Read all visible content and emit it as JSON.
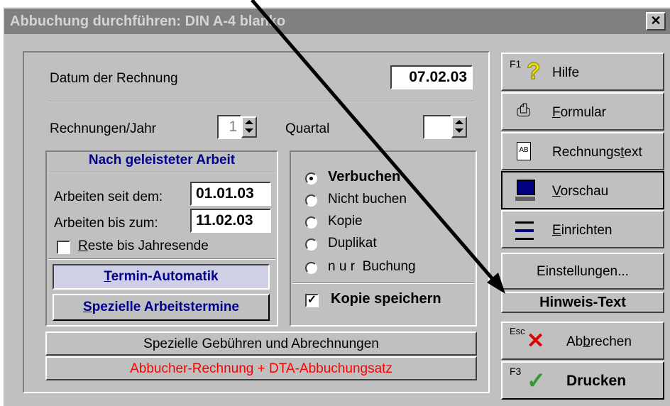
{
  "window": {
    "title": "Abbuchung durchführen: DIN A-4 blanko",
    "close_glyph": "✕"
  },
  "form": {
    "date_label": "Datum der Rechnung",
    "date_value": "07.02.03",
    "invoices_per_year_label": "Rechnungen/Jahr",
    "invoices_per_year_value": "1",
    "quarter_label": "Quartal",
    "quarter_value": ""
  },
  "work_group": {
    "title": "Nach geleisteter Arbeit",
    "since_label": "Arbeiten seit dem:",
    "since_value": "01.01.03",
    "until_label": "Arbeiten bis zum:",
    "until_value": "11.02.03",
    "rest_label_first": "R",
    "rest_label_rest": "este bis Jahresende",
    "rest_checked": false,
    "termin_first": "T",
    "termin_rest": "ermin-Automatik",
    "spezielle_first": "S",
    "spezielle_rest": "pezielle Arbeitstermine"
  },
  "booking_options": {
    "items": [
      {
        "label": "Verbuchen",
        "selected": true
      },
      {
        "label": "Nicht buchen",
        "selected": false
      },
      {
        "label": "Kopie",
        "selected": false
      },
      {
        "label": "Duplikat",
        "selected": false
      },
      {
        "label": "n u r  Buchung",
        "selected": false
      }
    ],
    "save_copy_label": "Kopie speichern",
    "save_copy_checked": true
  },
  "bottom_buttons": {
    "special_fees": "Spezielle Gebühren und Abrechnungen",
    "debit_invoice": "Abbucher-Rechnung + DTA-Abbuchungsatz",
    "debit_invoice_color": "#ff0000"
  },
  "side_buttons": {
    "help_key": "F1",
    "help_label": "Hilfe",
    "formular_first": "F",
    "formular_rest": "ormular",
    "rechnungstext_pre": "Rechnungs",
    "rechnungstext_ul": "t",
    "rechnungstext_post": "ext",
    "vorschau_first": "V",
    "vorschau_rest": "orschau",
    "einrichten_first": "E",
    "einrichten_rest": "inrichten",
    "einstellungen": "Einstellungen...",
    "hinweis": "Hinweis-Text",
    "cancel_key": "Esc",
    "cancel_pre": "Ab",
    "cancel_ul": "b",
    "cancel_post": "rechen",
    "print_key": "F3",
    "print_label": "Drucken"
  },
  "colors": {
    "link_blue": "#00008b",
    "accent_red": "#ff0000",
    "check_green": "#2e9b2e"
  }
}
